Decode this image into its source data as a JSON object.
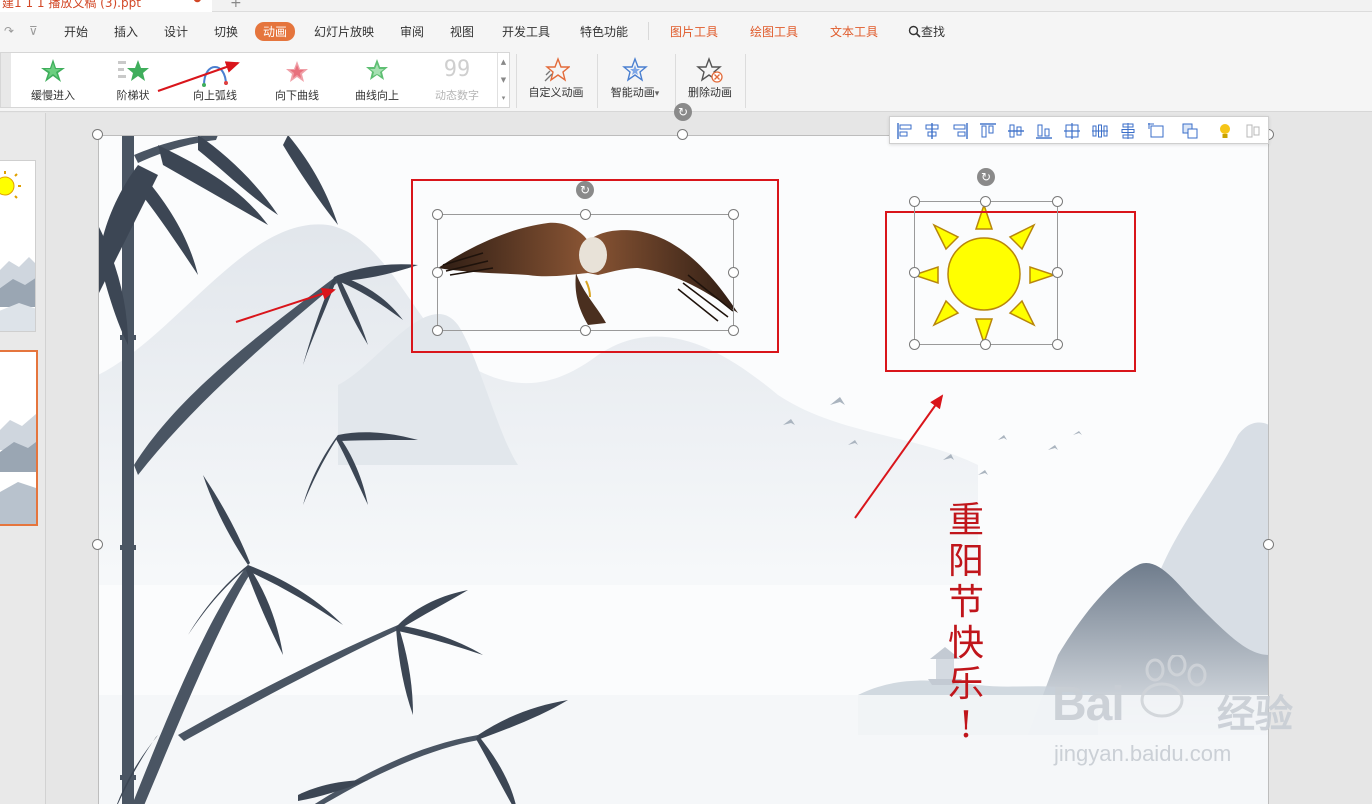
{
  "titlebar": {
    "doc_tab": "建1 1 1 播放文稿 (3).ppt",
    "close_glyph": "●",
    "new_tab_glyph": "+"
  },
  "quick_access": {
    "redo_glyph": "↷",
    "more_glyph": "⊽"
  },
  "menu": {
    "items": [
      "开始",
      "插入",
      "设计",
      "切换",
      "动画",
      "幻灯片放映",
      "审阅",
      "视图",
      "开发工具",
      "特色功能"
    ],
    "active": "动画",
    "context_items": [
      "图片工具",
      "绘图工具",
      "文本工具"
    ],
    "search_label": "查找"
  },
  "ribbon": {
    "gallery": [
      {
        "label": "缓慢进入",
        "icon": "green-star-icon"
      },
      {
        "label": "阶梯状",
        "icon": "stairs-star-icon"
      },
      {
        "label": "向上弧线",
        "icon": "arc-up-icon"
      },
      {
        "label": "向下曲线",
        "icon": "pink-star-curve-icon"
      },
      {
        "label": "曲线向上",
        "icon": "green-star-curve-icon"
      },
      {
        "label": "动态数字",
        "icon": "dynamic-number-icon",
        "disabled": true
      }
    ],
    "gallery_disabled_glyph": "99",
    "buttons": [
      {
        "label": "自定义动画",
        "icon": "custom-animation-icon"
      },
      {
        "label": "智能动画",
        "icon": "smart-animation-icon",
        "dropdown": "▾"
      },
      {
        "label": "删除动画",
        "icon": "delete-animation-icon"
      }
    ]
  },
  "slide": {
    "vertical_text": [
      "重",
      "阳",
      "节",
      "快",
      "乐",
      "!"
    ],
    "rotate_glyph": "↻"
  },
  "watermark": {
    "brand": "Bai",
    "brand_cn": "经验",
    "url": "jingyan.baidu.com"
  },
  "colors": {
    "accent": "#e5753d",
    "context_tab": "#e05b2b",
    "annotation_red": "#d9151b",
    "sun_yellow": "#ffff00",
    "text_red": "#c0151b"
  }
}
